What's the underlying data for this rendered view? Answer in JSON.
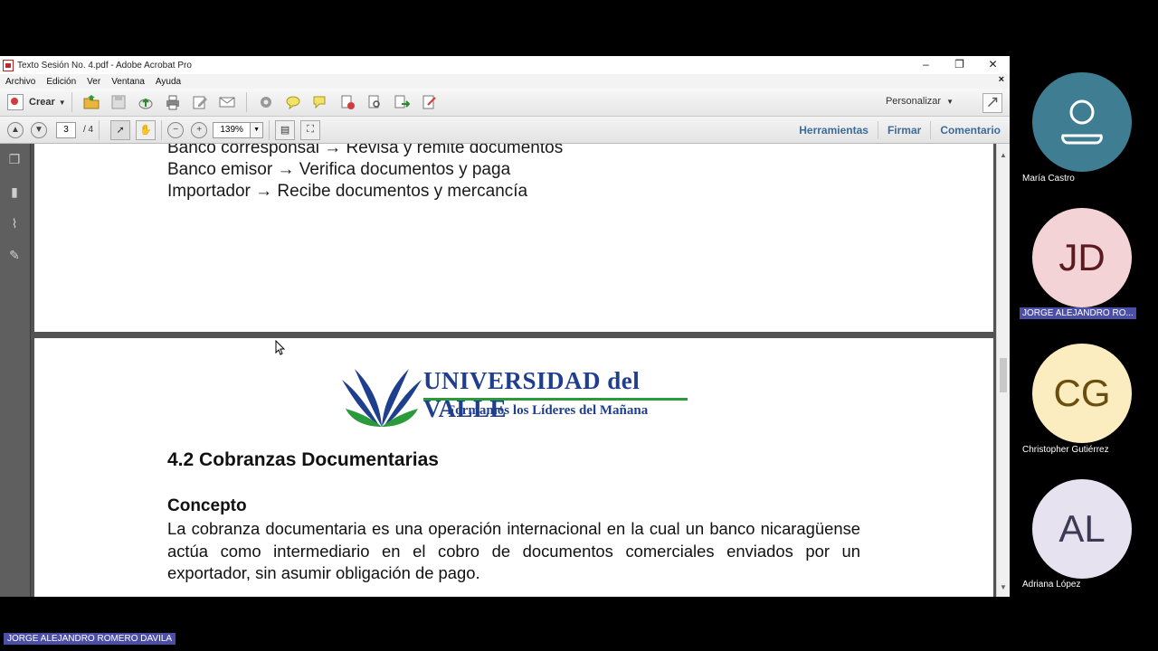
{
  "window": {
    "title": "Texto Sesión No. 4.pdf - Adobe Acrobat Pro",
    "minimize": "–",
    "restore": "❐",
    "close": "✕"
  },
  "menu": {
    "items": [
      "Archivo",
      "Edición",
      "Ver",
      "Ventana",
      "Ayuda"
    ],
    "close_doc": "×"
  },
  "toolbar": {
    "create_label": "Crear",
    "customize_label": "Personalizar",
    "icons": [
      "open-icon",
      "save-icon",
      "upload-icon",
      "print-icon",
      "edit-icon",
      "email-icon",
      "settings-icon",
      "comment-icon",
      "stamp-icon",
      "delete-icon",
      "search-icon",
      "export-icon",
      "form-icon"
    ]
  },
  "nav": {
    "current_page": "3",
    "total_pages": "/ 4",
    "zoom": "139%",
    "panels": [
      "Herramientas",
      "Firmar",
      "Comentario"
    ]
  },
  "document": {
    "page1_lines": [
      "Banco corresponsal → Revisa y remite documentos",
      "Banco emisor → Verifica documentos y paga",
      "Importador → Recibe documentos y mercancía"
    ],
    "logo_name": "UNIVERSIDAD del VALLE",
    "logo_slogan": "Formamos los Líderes del Mañana",
    "heading": "4.2 Cobranzas Documentarias",
    "subheading": "Concepto",
    "paragraph": "La cobranza documentaria es una operación internacional en la cual un banco nicaragüense actúa como intermediario en el cobro de documentos comerciales enviados por un exportador, sin asumir obligación de pago."
  },
  "participants": [
    {
      "initials": "",
      "name": "María Castro",
      "bg": "#3f7d92",
      "fg": "#ffffff"
    },
    {
      "initials": "JD",
      "name": "JORGE ALEJANDRO RO...",
      "bg": "#f3d3d6",
      "fg": "#5a1a20"
    },
    {
      "initials": "CG",
      "name": "Christopher Gutiérrez",
      "bg": "#fbedc0",
      "fg": "#6b4e0e"
    },
    {
      "initials": "AL",
      "name": "Adriana López",
      "bg": "#e6e2ef",
      "fg": "#3c3a55"
    }
  ],
  "presenter_name": "JORGE ALEJANDRO ROMERO DAVILA",
  "colors": {
    "panel_link": "#3d6b9a",
    "name_highlight": "#4c4fa8",
    "logo_blue": "#1f3f8e",
    "logo_green": "#2a9a3a"
  }
}
